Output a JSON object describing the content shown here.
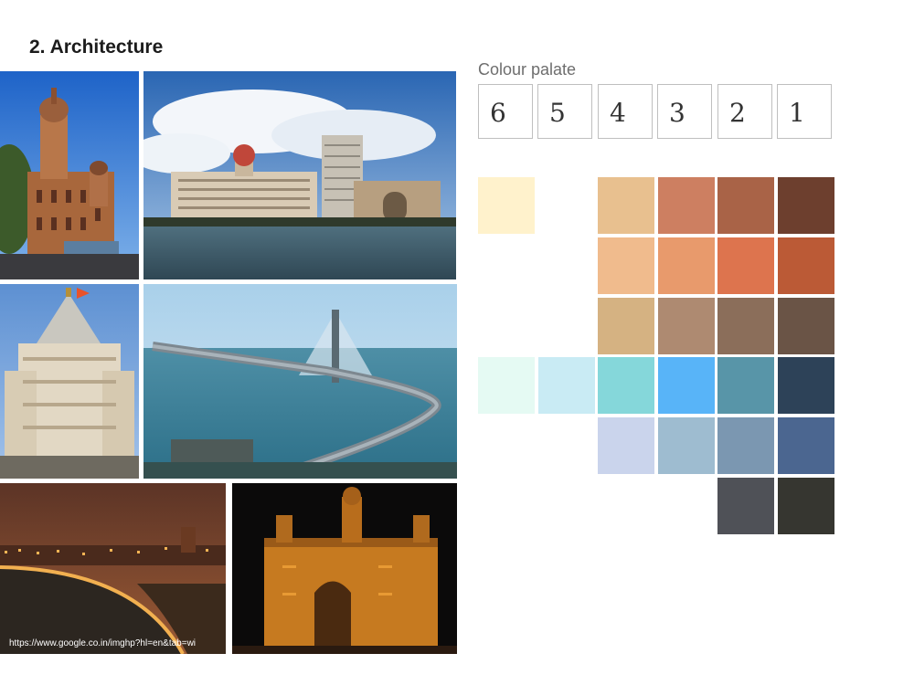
{
  "title": "2. Architecture",
  "photos": [
    {
      "name": "photo-bmc-building",
      "desc": "Gothic municipal building"
    },
    {
      "name": "photo-taj-hotel",
      "desc": "Taj hotel by the sea"
    },
    {
      "name": "photo-siddhivinayak-temple",
      "desc": "Temple spire"
    },
    {
      "name": "photo-sea-link-bridge",
      "desc": "Cable-stayed sea bridge"
    },
    {
      "name": "photo-marine-drive-night",
      "desc": "Curved seafront at night"
    },
    {
      "name": "photo-gateway-of-india-night",
      "desc": "Gateway arch lit at night"
    }
  ],
  "caption": "https://www.google.co.in/imghp?hl=en&tab=wi",
  "palate": {
    "label": "Colour palate",
    "columns": [
      "6",
      "5",
      "4",
      "3",
      "2",
      "1"
    ],
    "rows": [
      [
        "#fff2cc",
        "",
        "#e8c08f",
        "#cd7f61",
        "#a96347",
        "#6d3f2e"
      ],
      [
        "",
        "",
        "#f0bb8d",
        "#e89a6c",
        "#dd744e",
        "#bb5a36"
      ],
      [
        "",
        "",
        "#d5b282",
        "#ae8a71",
        "#8b6e5a",
        "#6a5446"
      ],
      [
        "#e5faf3",
        "#c9ebf4",
        "#85d7da",
        "#58b4f8",
        "#5895a8",
        "#2d4258"
      ],
      [
        "",
        "",
        "#cad4ec",
        "#9ebcd0",
        "#7b97b1",
        "#4b6690"
      ],
      [
        "",
        "",
        "",
        "",
        "#4f5157",
        "#363630"
      ]
    ]
  }
}
